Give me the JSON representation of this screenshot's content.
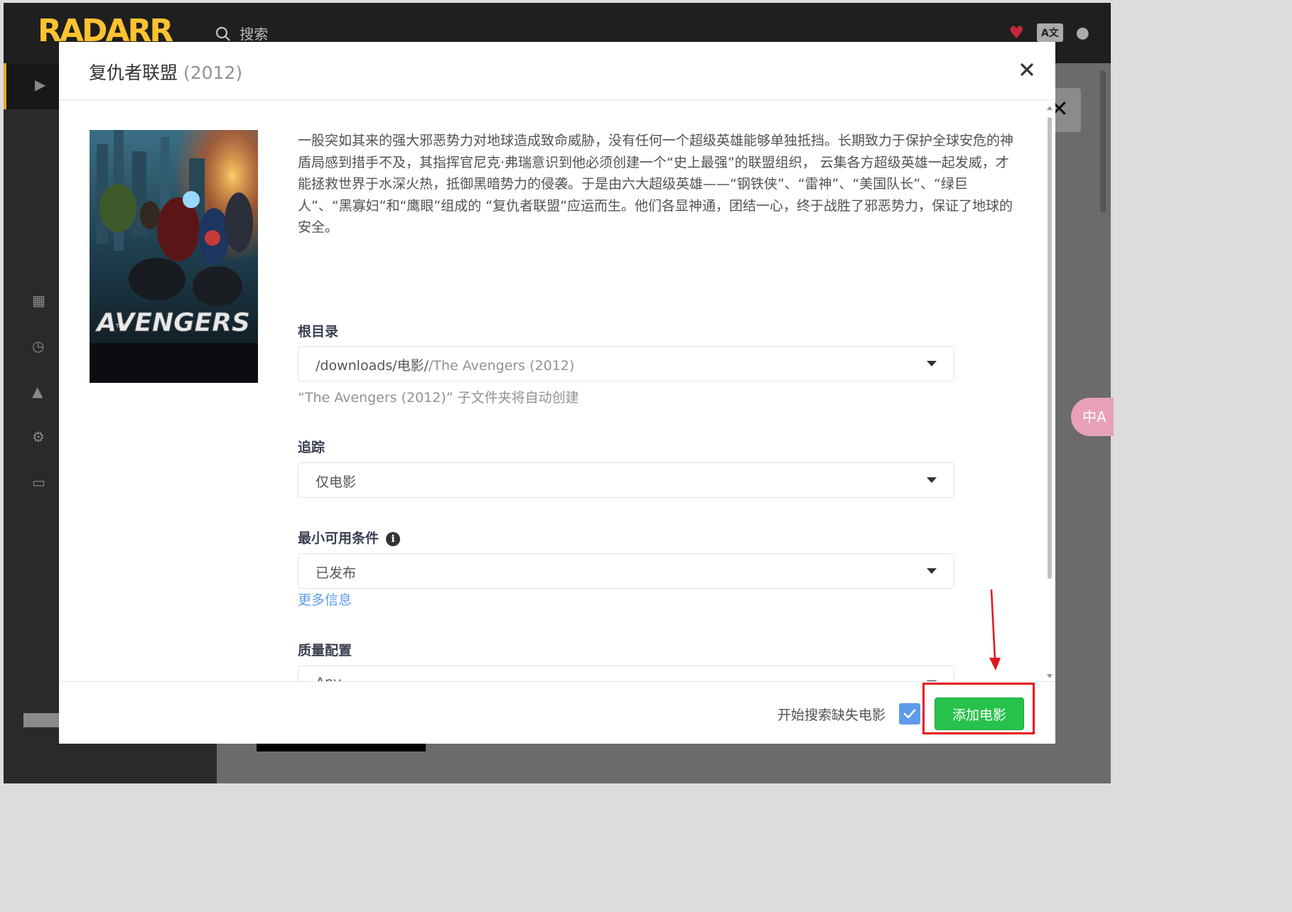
{
  "app": {
    "logo_text": "RADARR",
    "search_placeholder": "搜索",
    "translate_badge": "A文",
    "fab_text": "中A"
  },
  "modal": {
    "title": "复仇者联盟",
    "year": "(2012)",
    "poster_title": "AVENGERS",
    "poster_small": "THE",
    "overview": "一股突如其来的强大邪恶势力对地球造成致命威胁，没有任何一个超级英雄能够单独抵挡。长期致力于保护全球安危的神盾局感到措手不及，其指挥官尼克·弗瑞意识到他必须创建一个“史上最强”的联盟组织， 云集各方超级英雄一起发威，才能拯救世界于水深火热，抵御黑暗势力的侵袭。于是由六大超级英雄——“钢铁侠”、“雷神”、“美国队长”、“绿巨人”、“黑寡妇”和“鹰眼”组成的 “复仇者联盟”应运而生。他们各显神通，团结一心，终于战胜了邪恶势力，保证了地球的安全。",
    "fields": {
      "root_folder": {
        "label": "根目录",
        "value_main": "/downloads/电影/",
        "value_sub": "/The Avengers (2012)",
        "help": "“The Avengers (2012)” 子文件夹将自动创建"
      },
      "monitor": {
        "label": "追踪",
        "value": "仅电影"
      },
      "minimum_availability": {
        "label": "最小可用条件",
        "info_icon": "i",
        "value": "已发布",
        "more_info_link": "更多信息"
      },
      "quality_profile": {
        "label": "质量配置",
        "value": "Any"
      }
    },
    "footer": {
      "search_missing_label": "开始搜索缺失电影",
      "search_missing_checked": true,
      "add_button": "添加电影"
    }
  },
  "colors": {
    "accent": "#ffc230",
    "primary": "#5d9cec",
    "success": "#27c24c",
    "highlight": "#e6141e"
  }
}
